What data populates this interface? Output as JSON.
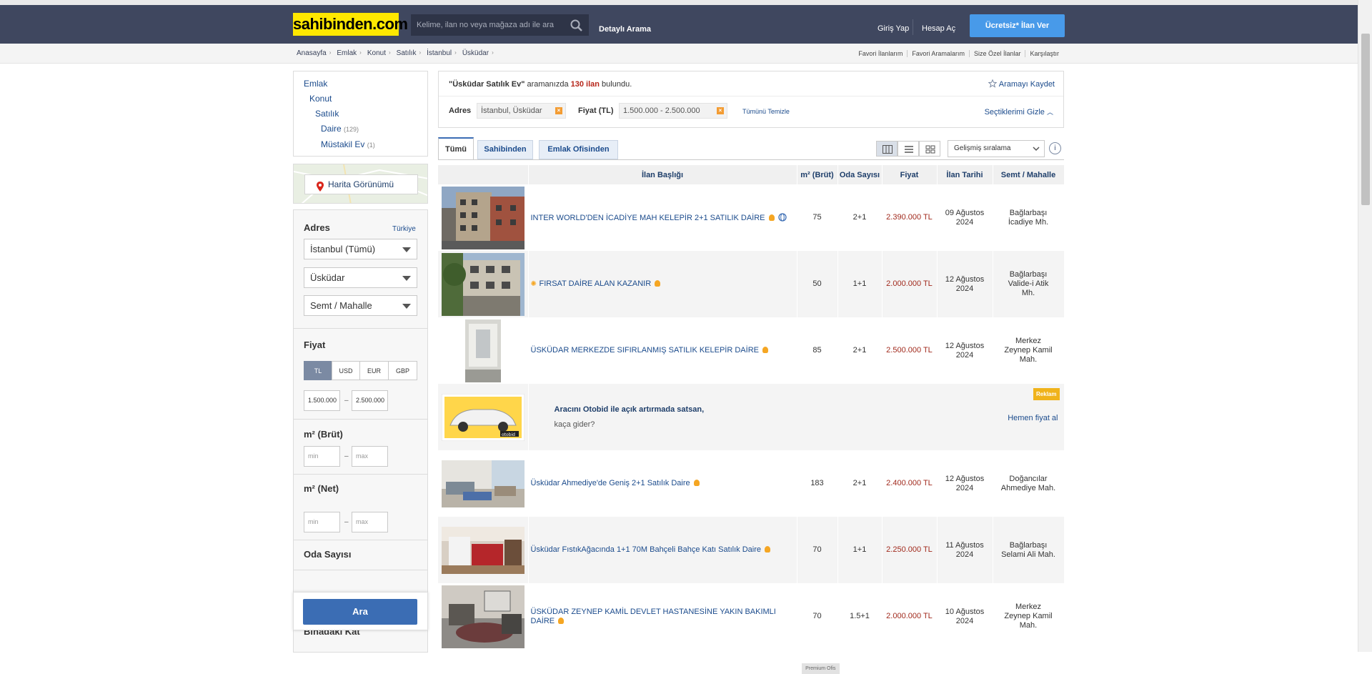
{
  "header": {
    "logo": "sahibinden.com",
    "search_placeholder": "Kelime, ilan no veya mağaza adı ile ara",
    "detailed_search": "Detaylı Arama",
    "login": "Giriş Yap",
    "register": "Hesap Aç",
    "post_ad": "Ücretsiz* İlan Ver"
  },
  "breadcrumbs": [
    "Anasayfa",
    "Emlak",
    "Konut",
    "Satılık",
    "İstanbul",
    "Üsküdar"
  ],
  "top_links": [
    "Favori İlanlarım",
    "Favori Aramalarım",
    "Size Özel İlanlar",
    "Karşılaştır"
  ],
  "categories": {
    "emlak": "Emlak",
    "konut": "Konut",
    "satilik": "Satılık",
    "daire": "Daire",
    "daire_count": "(129)",
    "mustakil": "Müstakil Ev",
    "mustakil_count": "(1)"
  },
  "map_button": "Harita Görünümü",
  "filters": {
    "address_title": "Adres",
    "address_link": "Türkiye",
    "province": "İstanbul (Tümü)",
    "district": "Üsküdar",
    "neighborhood": "Semt / Mahalle",
    "price_title": "Fiyat",
    "currencies": [
      "TL",
      "USD",
      "EUR",
      "GBP"
    ],
    "price_min": "1.500.000",
    "price_max": "2.500.000",
    "m2_gross_title": "m² (Brüt)",
    "m2_net_title": "m² (Net)",
    "min_placeholder": "min",
    "max_placeholder": "max",
    "rooms_title": "Oda Sayısı",
    "rooms_partial": "Binadaki Kat",
    "search_button": "Ara"
  },
  "results": {
    "query": "\"Üsküdar Satılık Ev\"",
    "mid_text": " aramanızda ",
    "count": "130 ilan",
    "found": " bulundu.",
    "save_search": "Aramayı Kaydet",
    "address_label": "Adres",
    "address_chip": "İstanbul, Üsküdar",
    "price_label": "Fiyat (TL)",
    "price_chip": "1.500.000 - 2.500.000",
    "clear_all": "Tümünü Temizle",
    "hide_selected": "Seçtiklerimi Gizle"
  },
  "tabs": [
    "Tümü",
    "Sahibinden",
    "Emlak Ofisinden"
  ],
  "sort": "Gelişmiş sıralama",
  "table": {
    "headers": [
      "İlan Başlığı",
      "m² (Brüt)",
      "Oda Sayısı",
      "Fiyat",
      "İlan Tarihi",
      "Semt / Mahalle"
    ],
    "rows": [
      {
        "title": "INTER WORLD'DEN İCADİYE MAH KELEPİR 2+1 SATILIK DAİRE",
        "m2": "75",
        "rooms": "2+1",
        "price": "2.390.000 TL",
        "date1": "09 Ağustos",
        "date2": "2024",
        "loc1": "Bağlarbaşı",
        "loc2": "İcadiye Mh.",
        "loc3": ""
      },
      {
        "title": "FIRSAT DAİRE ALAN KAZANIR",
        "m2": "50",
        "rooms": "1+1",
        "price": "2.000.000 TL",
        "date1": "12 Ağustos",
        "date2": "2024",
        "loc1": "Bağlarbaşı",
        "loc2": "Valide-i Atik",
        "loc3": "Mh."
      },
      {
        "title": "ÜSKÜDAR MERKEZDE SIFIRLANMIŞ SATILIK KELEPİR DAİRE",
        "m2": "85",
        "rooms": "2+1",
        "price": "2.500.000 TL",
        "date1": "12 Ağustos",
        "date2": "2024",
        "loc1": "Merkez",
        "loc2": "Zeynep Kamil",
        "loc3": "Mah."
      },
      {
        "title": "Üsküdar Ahmediye'de Geniş 2+1 Satılık Daire",
        "m2": "183",
        "rooms": "2+1",
        "price": "2.400.000 TL",
        "date1": "12 Ağustos",
        "date2": "2024",
        "loc1": "Doğancılar",
        "loc2": "Ahmediye Mah.",
        "loc3": ""
      },
      {
        "title": "Üsküdar FıstıkAğacında 1+1 70M Bahçeli Bahçe Katı Satılık Daire",
        "m2": "70",
        "rooms": "1+1",
        "price": "2.250.000 TL",
        "date1": "11 Ağustos",
        "date2": "2024",
        "loc1": "Bağlarbaşı",
        "loc2": "Selami Ali Mah.",
        "loc3": ""
      },
      {
        "title": "ÜSKÜDAR ZEYNEP KAMİL DEVLET HASTANESİNE YAKIN BAKIMLI DAİRE",
        "m2": "70",
        "rooms": "1.5+1",
        "price": "2.000.000 TL",
        "date1": "10 Ağustos",
        "date2": "2024",
        "loc1": "Merkez",
        "loc2": "Zeynep Kamil",
        "loc3": "Mah."
      }
    ],
    "premium_badge": "Premium Ofis"
  },
  "ad": {
    "title": "Aracını Otobid ile açık artırmada satsan,",
    "subtitle": "kaça gider?",
    "badge": "Reklam",
    "cta": "Hemen fiyat al",
    "logo": "otobid"
  },
  "colors": {
    "header_bg": "#3f475f",
    "logo_bg": "#ffe800",
    "accent_blue": "#489ae9",
    "price_red": "#a12a1d",
    "link_blue": "#1b4b8c"
  }
}
